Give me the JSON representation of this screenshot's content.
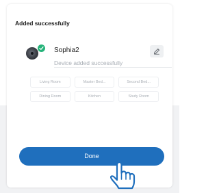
{
  "dialog": {
    "title": "Added successfully",
    "device": {
      "name": "Sophia2",
      "status": "Device added successfully",
      "icon": "camera-icon",
      "badge_icon": "check-icon"
    },
    "edit_icon": "pencil-icon",
    "rooms": [
      "Living Room",
      "Master Bed...",
      "Second Bed...",
      "Dining Room",
      "Kitchen",
      "Study Room"
    ],
    "done_label": "Done"
  },
  "colors": {
    "accent": "#1f6fbd",
    "success": "#26b37a",
    "background": "#f1f2f4"
  },
  "overlay_icon": "pointing-hand-icon"
}
